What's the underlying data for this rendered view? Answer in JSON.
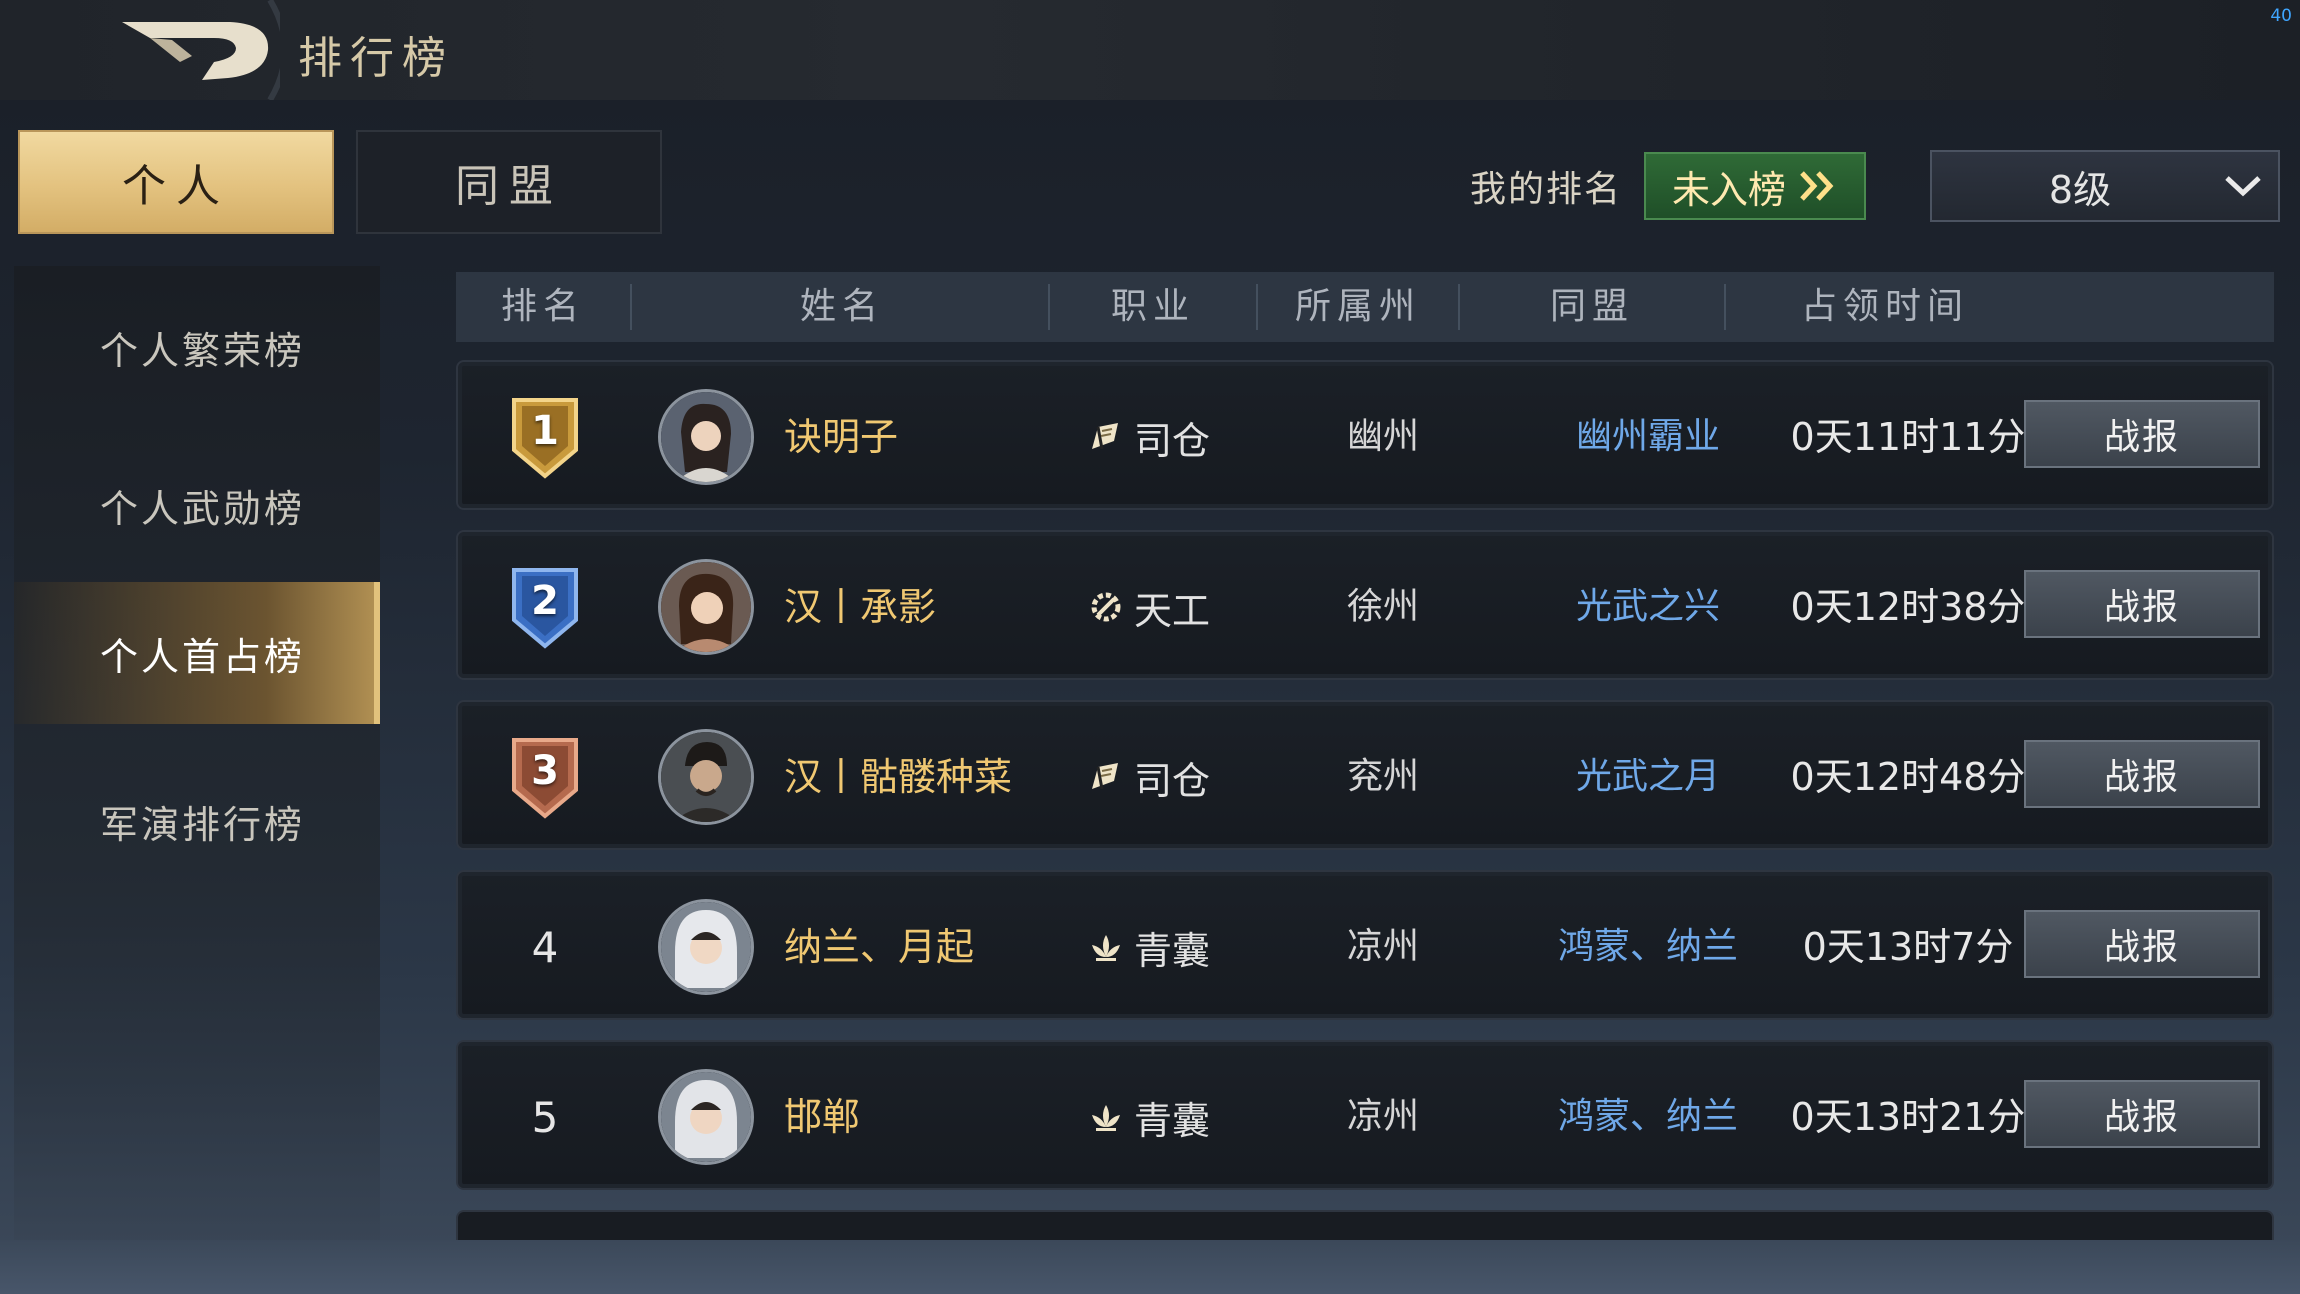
{
  "header": {
    "title": "排行榜",
    "fps": "40"
  },
  "tabs": [
    {
      "label": "个人",
      "active": true
    },
    {
      "label": "同盟",
      "active": false
    }
  ],
  "my_rank": {
    "label": "我的排名",
    "status": "未入榜"
  },
  "level_filter": {
    "selected": "8级"
  },
  "sidebar": {
    "items": [
      {
        "label": "个人繁荣榜",
        "active": false
      },
      {
        "label": "个人武勋榜",
        "active": false
      },
      {
        "label": "个人首占榜",
        "active": true
      },
      {
        "label": "军演排行榜",
        "active": false
      }
    ]
  },
  "table": {
    "headers": {
      "rank": "排名",
      "name": "姓名",
      "job": "职业",
      "state": "所属州",
      "alliance": "同盟",
      "occupy": "占领时间"
    },
    "rows": [
      {
        "rank": "1",
        "name": "诀明子",
        "job": "司仓",
        "job_icon": "granary-flag-icon",
        "state": "幽州",
        "alliance": "幽州霸业",
        "time": "0天11时11分",
        "report": "战报"
      },
      {
        "rank": "2",
        "name": "汉丨承影",
        "job": "天工",
        "job_icon": "gear-tool-icon",
        "state": "徐州",
        "alliance": "光武之兴",
        "time": "0天12时38分",
        "report": "战报"
      },
      {
        "rank": "3",
        "name": "汉丨骷髅种菜",
        "job": "司仓",
        "job_icon": "granary-flag-icon",
        "state": "兖州",
        "alliance": "光武之月",
        "time": "0天12时48分",
        "report": "战报"
      },
      {
        "rank": "4",
        "name": "纳兰、月起",
        "job": "青囊",
        "job_icon": "lotus-icon",
        "state": "凉州",
        "alliance": "鸿蒙、纳兰",
        "time": "0天13时7分",
        "report": "战报"
      },
      {
        "rank": "5",
        "name": "邯郸",
        "job": "青囊",
        "job_icon": "lotus-icon",
        "state": "凉州",
        "alliance": "鸿蒙、纳兰",
        "time": "0天13时21分",
        "report": "战报"
      }
    ]
  },
  "colors": {
    "gold_tab": "#e3c27f",
    "name_gold": "#f0c872",
    "alliance_blue": "#6fa8e8",
    "rank_green": "#2f6a36",
    "badge_gold": "#c99a3c",
    "badge_blue": "#3b6fc4",
    "badge_bronze": "#b56a4e"
  }
}
